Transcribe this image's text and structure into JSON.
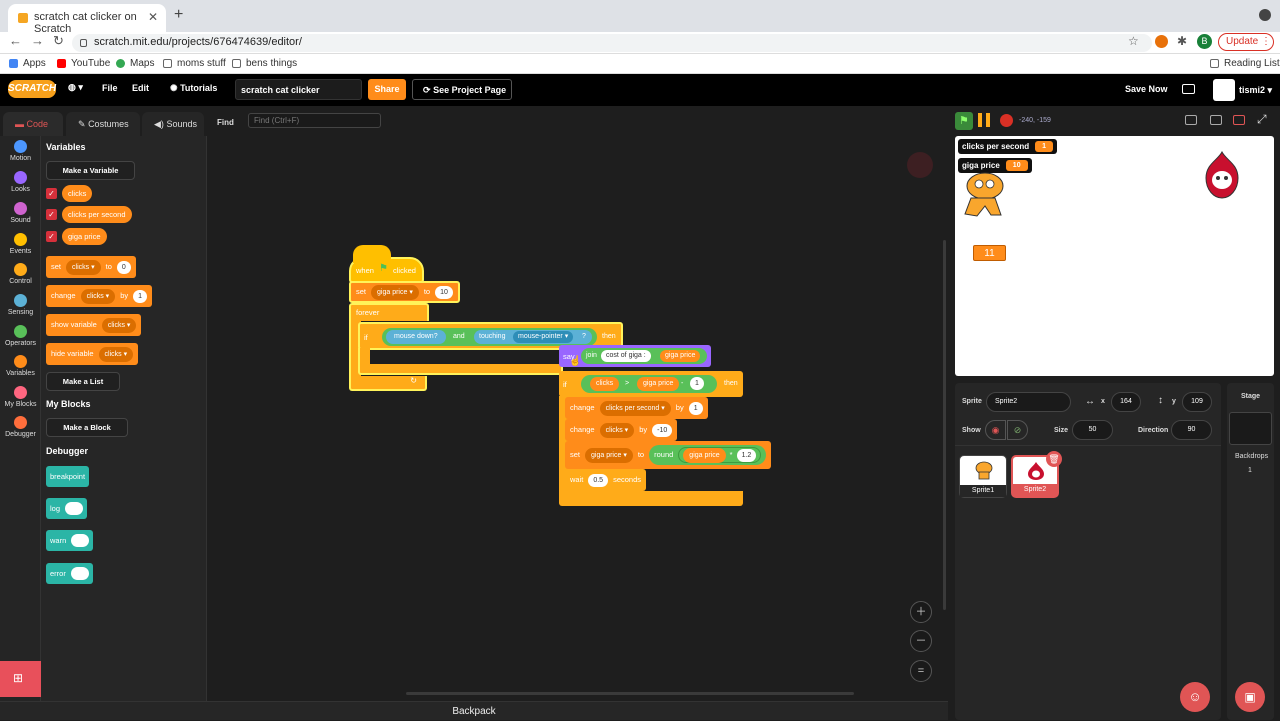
{
  "browser": {
    "tab_title": "scratch cat clicker on Scratch",
    "url": "scratch.mit.edu/projects/676474639/editor/",
    "update_label": "Update",
    "avatar_letter": "B",
    "bookmarks": [
      "Apps",
      "YouTube",
      "Maps",
      "moms stuff",
      "bens things"
    ],
    "reading_list": "Reading List"
  },
  "menubar": {
    "logo": "SCRATCH",
    "file": "File",
    "edit": "Edit",
    "tutorials": "Tutorials",
    "project_name": "scratch cat clicker",
    "share": "Share",
    "see_project": "See Project Page",
    "save_now": "Save Now",
    "username": "tismi2"
  },
  "tabs": {
    "code": "Code",
    "costumes": "Costumes",
    "sounds": "Sounds"
  },
  "find": {
    "label": "Find",
    "placeholder": "Find (Ctrl+F)"
  },
  "categories": [
    {
      "label": "Motion",
      "color": "#4c97ff"
    },
    {
      "label": "Looks",
      "color": "#9966ff"
    },
    {
      "label": "Sound",
      "color": "#cf63cf"
    },
    {
      "label": "Events",
      "color": "#ffbf00"
    },
    {
      "label": "Control",
      "color": "#ffab19"
    },
    {
      "label": "Sensing",
      "color": "#5cb1d6"
    },
    {
      "label": "Operators",
      "color": "#59c059"
    },
    {
      "label": "Variables",
      "color": "#ff8c1a"
    },
    {
      "label": "My Blocks",
      "color": "#ff6680"
    },
    {
      "label": "Debugger",
      "color": "#ff6e3c"
    }
  ],
  "palette": {
    "variables_heading": "Variables",
    "make_variable": "Make a Variable",
    "vars": [
      "clicks",
      "clicks per second",
      "giga price"
    ],
    "set_block": {
      "word": "set",
      "var": "clicks",
      "to": "to",
      "value": "0"
    },
    "change_block": {
      "word": "change",
      "var": "clicks",
      "by": "by",
      "value": "1"
    },
    "show_block": {
      "word": "show variable",
      "var": "clicks"
    },
    "hide_block": {
      "word": "hide variable",
      "var": "clicks"
    },
    "make_list": "Make a List",
    "myblocks_heading": "My Blocks",
    "make_block": "Make a Block",
    "debugger_heading": "Debugger",
    "debug_blocks": [
      "breakpoint",
      "log",
      "warn",
      "error"
    ]
  },
  "script": {
    "hat": {
      "when": "when",
      "clicked": "clicked"
    },
    "set_giga": {
      "word": "set",
      "var": "giga price",
      "to": "to",
      "value": "10"
    },
    "forever": "forever",
    "if_word": "if",
    "mouse_down": "mouse down?",
    "and": "and",
    "touching": "touching",
    "touch_target": "mouse-pointer",
    "q": "?",
    "then": "then",
    "say": "say",
    "join": "join",
    "join_text": "cost of giga :",
    "join_var": "giga price",
    "if2_var": "clicks",
    "gt": ">",
    "if2_var2": "giga price",
    "minus": "-",
    "if2_num": "1",
    "change1": {
      "word": "change",
      "var": "clicks per second",
      "by": "by",
      "value": "1"
    },
    "change2": {
      "word": "change",
      "var": "clicks",
      "by": "by",
      "value": "-10"
    },
    "set2": {
      "word": "set",
      "var": "giga price",
      "to": "to",
      "round": "round",
      "var2": "giga price",
      "op": "*",
      "value": "1.2"
    },
    "wait": {
      "word": "wait",
      "value": "0.5",
      "unit": "seconds"
    }
  },
  "backpack": "Backpack",
  "stage": {
    "coords": "-240, -159",
    "monitors": [
      {
        "label": "clicks per second",
        "value": "1"
      },
      {
        "label": "giga price",
        "value": "10"
      }
    ],
    "clicks_display": "11"
  },
  "sprite_info": {
    "sprite_label": "Sprite",
    "sprite_name": "Sprite2",
    "x_label": "x",
    "x": "164",
    "y_label": "y",
    "y": "109",
    "show_label": "Show",
    "size_label": "Size",
    "size": "50",
    "direction_label": "Direction",
    "direction": "90",
    "sprites": [
      "Sprite1",
      "Sprite2"
    ]
  },
  "stage_panel": {
    "label": "Stage",
    "backdrops_label": "Backdrops",
    "backdrops_count": "1"
  }
}
